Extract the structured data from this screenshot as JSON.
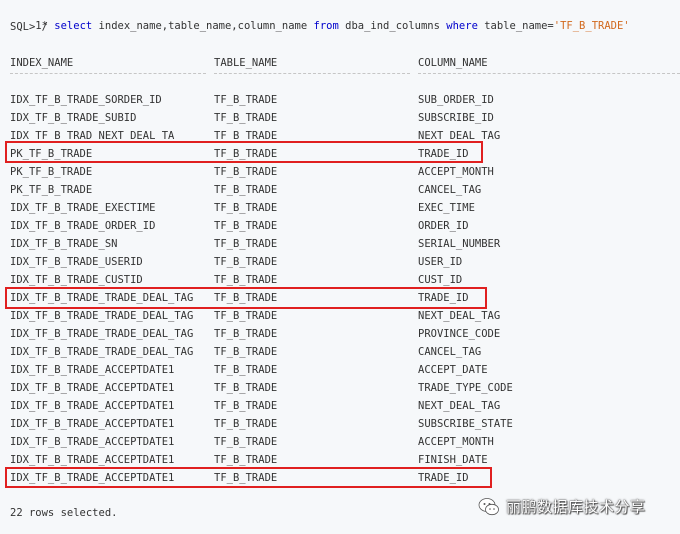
{
  "editor": {
    "line_number": "1",
    "line_marker": "*",
    "kw_select": "select",
    "select_columns": "index_name,table_name,column_name",
    "kw_from": "from",
    "from_table": "dba_ind_columns",
    "kw_where": "where",
    "where_clause": "table_name=",
    "where_value": "'TF_B_TRADE'",
    "prompt": "SQL> /"
  },
  "table": {
    "headers": [
      "INDEX_NAME",
      "TABLE_NAME",
      "COLUMN_NAME"
    ],
    "rows": [
      [
        "IDX_TF_B_TRADE_SORDER_ID",
        "TF_B_TRADE",
        "SUB_ORDER_ID"
      ],
      [
        "IDX_TF_B_TRADE_SUBID",
        "TF_B_TRADE",
        "SUBSCRIBE_ID"
      ],
      [
        "IDX_TF_B_TRAD_NEXT_DEAL_TA",
        "TF_B_TRADE",
        "NEXT_DEAL_TAG"
      ],
      [
        "PK_TF_B_TRADE",
        "TF_B_TRADE",
        "TRADE_ID"
      ],
      [
        "PK_TF_B_TRADE",
        "TF_B_TRADE",
        "ACCEPT_MONTH"
      ],
      [
        "PK_TF_B_TRADE",
        "TF_B_TRADE",
        "CANCEL_TAG"
      ],
      [
        "IDX_TF_B_TRADE_EXECTIME",
        "TF_B_TRADE",
        "EXEC_TIME"
      ],
      [
        "IDX_TF_B_TRADE_ORDER_ID",
        "TF_B_TRADE",
        "ORDER_ID"
      ],
      [
        "IDX_TF_B_TRADE_SN",
        "TF_B_TRADE",
        "SERIAL_NUMBER"
      ],
      [
        "IDX_TF_B_TRADE_USERID",
        "TF_B_TRADE",
        "USER_ID"
      ],
      [
        "IDX_TF_B_TRADE_CUSTID",
        "TF_B_TRADE",
        "CUST_ID"
      ],
      [
        "IDX_TF_B_TRADE_TRADE_DEAL_TAG",
        "TF_B_TRADE",
        "TRADE_ID"
      ],
      [
        "IDX_TF_B_TRADE_TRADE_DEAL_TAG",
        "TF_B_TRADE",
        "NEXT_DEAL_TAG"
      ],
      [
        "IDX_TF_B_TRADE_TRADE_DEAL_TAG",
        "TF_B_TRADE",
        "PROVINCE_CODE"
      ],
      [
        "IDX_TF_B_TRADE_TRADE_DEAL_TAG",
        "TF_B_TRADE",
        "CANCEL_TAG"
      ],
      [
        "IDX_TF_B_TRADE_ACCEPTDATE1",
        "TF_B_TRADE",
        "ACCEPT_DATE"
      ],
      [
        "IDX_TF_B_TRADE_ACCEPTDATE1",
        "TF_B_TRADE",
        "TRADE_TYPE_CODE"
      ],
      [
        "IDX_TF_B_TRADE_ACCEPTDATE1",
        "TF_B_TRADE",
        "NEXT_DEAL_TAG"
      ],
      [
        "IDX_TF_B_TRADE_ACCEPTDATE1",
        "TF_B_TRADE",
        "SUBSCRIBE_STATE"
      ],
      [
        "IDX_TF_B_TRADE_ACCEPTDATE1",
        "TF_B_TRADE",
        "ACCEPT_MONTH"
      ],
      [
        "IDX_TF_B_TRADE_ACCEPTDATE1",
        "TF_B_TRADE",
        "FINISH_DATE"
      ],
      [
        "IDX_TF_B_TRADE_ACCEPTDATE1",
        "TF_B_TRADE",
        "TRADE_ID"
      ]
    ]
  },
  "footer": {
    "text": "22 rows selected."
  },
  "watermark": {
    "text": "丽鹏数据库技术分享",
    "icon": "wechat-icon"
  },
  "colors": {
    "keyword": "#0000cc",
    "string": "#d2691e",
    "highlight_box": "#e02020",
    "background": "#f6f8fa"
  }
}
